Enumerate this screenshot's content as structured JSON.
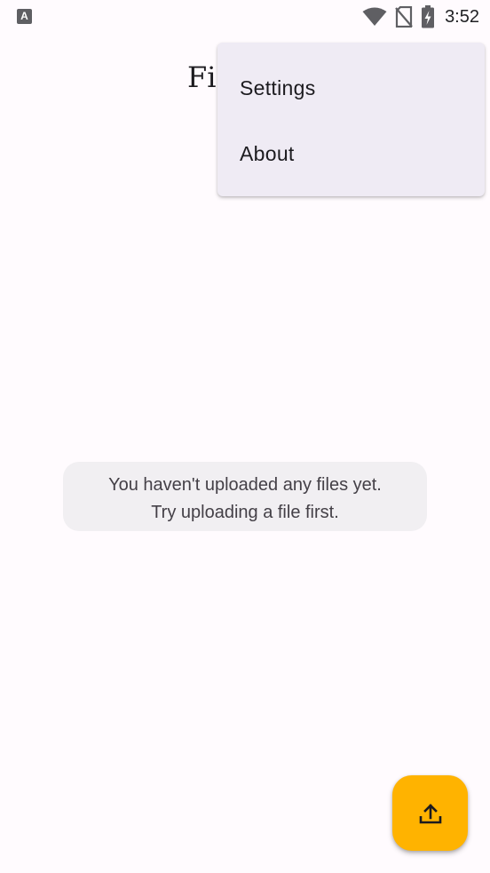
{
  "status_bar": {
    "app_icon_letter": "A",
    "time": "3:52",
    "icons": [
      "wifi-icon",
      "no-sim-icon",
      "battery-charging-icon"
    ]
  },
  "app_bar": {
    "title": "Fi"
  },
  "overflow_menu": {
    "items": [
      {
        "label": "Settings"
      },
      {
        "label": "About"
      }
    ]
  },
  "empty_state": {
    "line1": "You haven't uploaded any files yet.",
    "line2": "Try uploading a file first."
  },
  "fab": {
    "icon": "upload-icon",
    "color": "#ffb300"
  },
  "colors": {
    "background": "#fffbfe",
    "menu_background": "#efebf4",
    "card_background": "#f1eff2",
    "accent": "#ffb300"
  }
}
